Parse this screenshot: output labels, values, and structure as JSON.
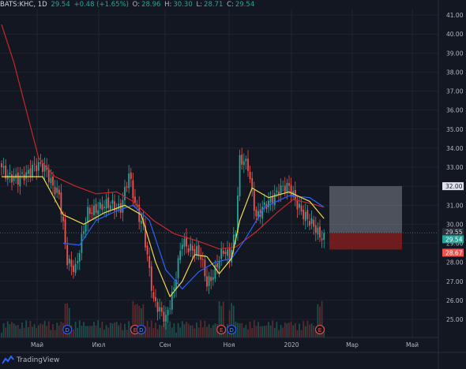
{
  "header": {
    "symbol": "BATS:KHC, 1D",
    "last": "29.54",
    "change": "+0.48 (+1.65%)",
    "o_label": "O:",
    "o_value": "28.96",
    "h_label": "H:",
    "h_value": "30.30",
    "l_label": "L:",
    "l_value": "28.71",
    "c_label": "C:",
    "c_value": "29.54"
  },
  "brand": {
    "label": "TradingView"
  },
  "colors": {
    "background": "#131722",
    "grid": "#2a2e39",
    "bull": "#26a69a",
    "bear": "#ef5350",
    "ma_fast": "#f0d84a",
    "ma_mid": "#2962ff",
    "ma_slow": "#c62828",
    "target_zone": "#9598a1",
    "stop_zone": "#7f1d1d"
  },
  "chart_data": {
    "type": "candlestick",
    "y_ticks": [
      "41.00",
      "40.00",
      "39.00",
      "38.00",
      "37.00",
      "36.00",
      "35.00",
      "34.00",
      "33.00",
      "32.00",
      "31.00",
      "30.00",
      "29.00",
      "28.00",
      "27.00",
      "26.00",
      "25.00"
    ],
    "ylim": [
      24.2,
      41.1
    ],
    "x_ticks": [
      "Май",
      "Июл",
      "Сен",
      "Ноя",
      "2020",
      "Мар",
      "Май"
    ],
    "price_labels": [
      {
        "text": "32.00",
        "value": 32.0,
        "kind": "target"
      },
      {
        "text": "29.55",
        "value": 29.55,
        "kind": "crosshair"
      },
      {
        "text": "29.54",
        "value": 29.54,
        "kind": "last"
      },
      {
        "text": "28.67",
        "value": 28.67,
        "kind": "stop"
      }
    ],
    "anchors": [
      [
        0,
        33.0
      ],
      [
        8,
        32.2
      ],
      [
        15,
        33.1
      ],
      [
        22,
        32.8
      ],
      [
        28,
        31.5
      ],
      [
        32,
        28.0
      ],
      [
        36,
        27.8
      ],
      [
        42,
        30.5
      ],
      [
        47,
        31.0
      ],
      [
        52,
        30.9
      ],
      [
        58,
        31.0
      ],
      [
        62,
        32.5
      ],
      [
        65,
        31.0
      ],
      [
        69,
        30.0
      ],
      [
        74,
        25.8
      ],
      [
        80,
        25.2
      ],
      [
        84,
        26.5
      ],
      [
        88,
        29.2
      ],
      [
        92,
        28.8
      ],
      [
        97,
        28.2
      ],
      [
        100,
        27.0
      ],
      [
        104,
        27.6
      ],
      [
        108,
        28.5
      ],
      [
        111,
        28.4
      ],
      [
        114,
        29.8
      ],
      [
        116,
        33.3
      ],
      [
        120,
        33.0
      ],
      [
        124,
        30.5
      ],
      [
        130,
        31.0
      ],
      [
        135,
        32.0
      ],
      [
        140,
        31.8
      ],
      [
        145,
        31.0
      ],
      [
        150,
        30.0
      ],
      [
        155,
        29.5
      ],
      [
        157,
        29.5
      ]
    ],
    "ma_fast": [
      [
        0,
        32.5
      ],
      [
        20,
        32.5
      ],
      [
        30,
        30.5
      ],
      [
        40,
        30.0
      ],
      [
        50,
        30.6
      ],
      [
        60,
        31.0
      ],
      [
        68,
        30.5
      ],
      [
        75,
        28.0
      ],
      [
        82,
        26.2
      ],
      [
        88,
        27.0
      ],
      [
        94,
        28.4
      ],
      [
        100,
        28.3
      ],
      [
        106,
        27.4
      ],
      [
        112,
        28.2
      ],
      [
        116,
        30.2
      ],
      [
        122,
        31.9
      ],
      [
        130,
        31.4
      ],
      [
        140,
        31.7
      ],
      [
        150,
        31.2
      ],
      [
        157,
        30.3
      ]
    ],
    "ma_mid": [
      [
        30,
        29.0
      ],
      [
        38,
        28.9
      ],
      [
        46,
        30.2
      ],
      [
        56,
        30.7
      ],
      [
        64,
        31.0
      ],
      [
        72,
        30.2
      ],
      [
        80,
        27.6
      ],
      [
        88,
        26.6
      ],
      [
        96,
        27.5
      ],
      [
        104,
        28.0
      ],
      [
        112,
        28.2
      ],
      [
        118,
        29.1
      ],
      [
        128,
        30.9
      ],
      [
        140,
        31.5
      ],
      [
        150,
        31.4
      ],
      [
        157,
        30.9
      ]
    ],
    "ma_slow": [
      [
        0,
        40.5
      ],
      [
        6,
        38.5
      ],
      [
        12,
        36.0
      ],
      [
        18,
        33.5
      ],
      [
        26,
        32.5
      ],
      [
        36,
        32.0
      ],
      [
        46,
        31.6
      ],
      [
        56,
        31.7
      ],
      [
        64,
        31.2
      ],
      [
        74,
        30.2
      ],
      [
        84,
        29.5
      ],
      [
        96,
        29.1
      ],
      [
        106,
        28.7
      ],
      [
        114,
        28.8
      ],
      [
        124,
        29.6
      ],
      [
        134,
        30.6
      ],
      [
        142,
        31.3
      ],
      [
        150,
        31.1
      ],
      [
        157,
        30.9
      ]
    ],
    "position_tool": {
      "entry": 29.55,
      "target": 32.0,
      "stop": 28.67
    },
    "event_markers": [
      {
        "text": "D",
        "type": "dividend"
      },
      {
        "text": "E",
        "type": "earnings"
      },
      {
        "text": "D",
        "type": "dividend"
      },
      {
        "text": "E",
        "type": "earnings"
      },
      {
        "text": "D",
        "type": "dividend"
      },
      {
        "text": "E",
        "type": "earnings"
      }
    ],
    "marker_bars": [
      32,
      65,
      68,
      107,
      112,
      155
    ]
  }
}
